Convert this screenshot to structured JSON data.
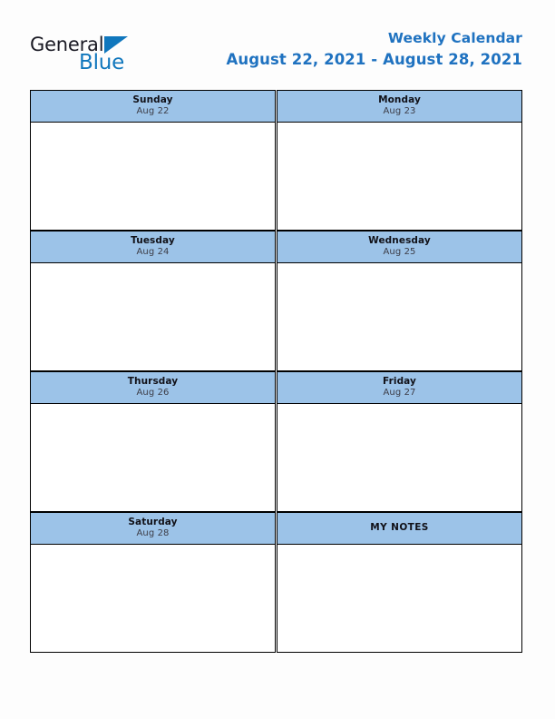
{
  "brand": {
    "name_part1": "General",
    "name_part2": "Blue",
    "logo_icon": "blue-triangle-flag-icon",
    "brand_color": "#1077bd",
    "text_color": "#1a1a24"
  },
  "header": {
    "title": "Weekly Calendar",
    "date_range": "August 22, 2021 - August 28, 2021",
    "title_color": "#1f72c0"
  },
  "calendar": {
    "header_fill": "#9cc3e8",
    "border_color": "#000000",
    "body_fill": "#ffffff",
    "rows": [
      {
        "left": {
          "day": "Sunday",
          "date": "Aug 22",
          "body_text": ""
        },
        "right": {
          "day": "Monday",
          "date": "Aug 23",
          "body_text": ""
        }
      },
      {
        "left": {
          "day": "Tuesday",
          "date": "Aug 24",
          "body_text": ""
        },
        "right": {
          "day": "Wednesday",
          "date": "Aug 25",
          "body_text": ""
        }
      },
      {
        "left": {
          "day": "Thursday",
          "date": "Aug 26",
          "body_text": ""
        },
        "right": {
          "day": "Friday",
          "date": "Aug 27",
          "body_text": ""
        }
      },
      {
        "left": {
          "day": "Saturday",
          "date": "Aug 28",
          "body_text": ""
        },
        "right": {
          "day": "MY NOTES",
          "date": "",
          "body_text": ""
        }
      }
    ]
  }
}
